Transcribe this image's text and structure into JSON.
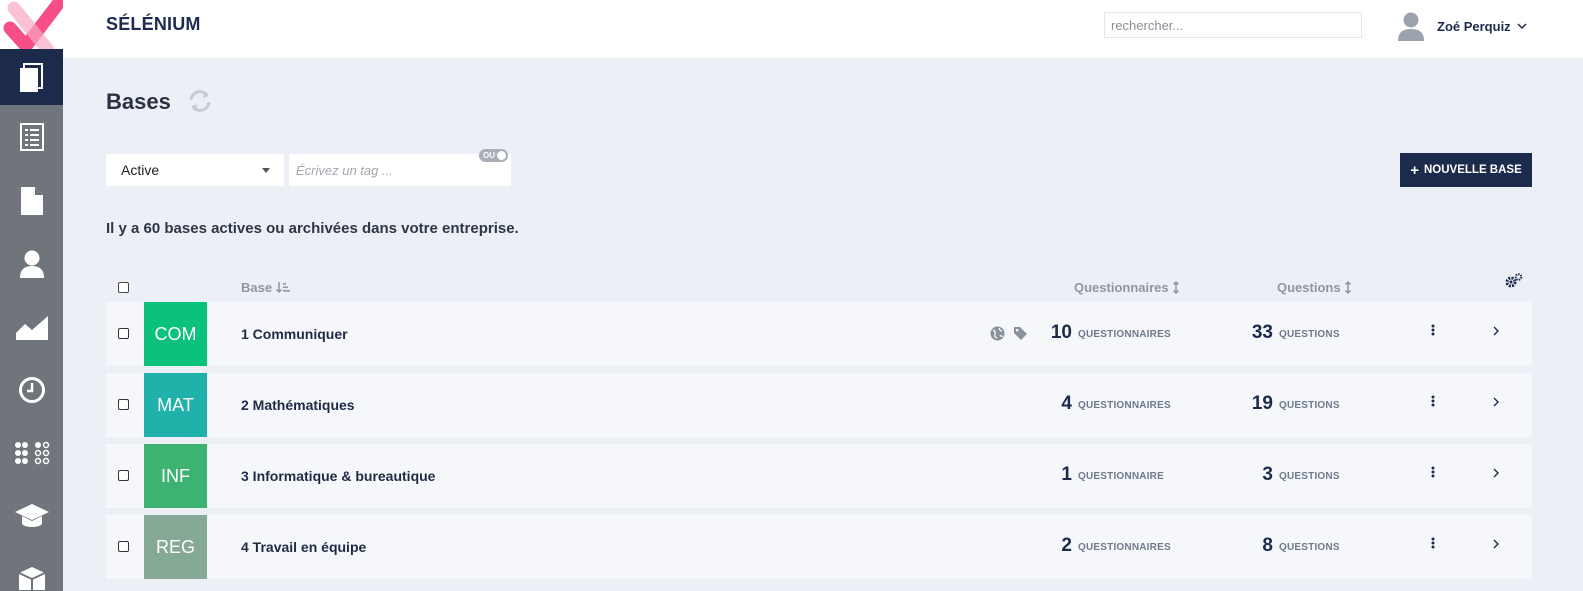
{
  "app": {
    "title": "SÉLÉNIUM"
  },
  "search": {
    "placeholder": "rechercher..."
  },
  "user": {
    "name": "Zoé Perquiz"
  },
  "sidebar": {
    "items": [
      {
        "icon": "documents-icon",
        "active": true
      },
      {
        "icon": "list-icon",
        "active": false
      },
      {
        "icon": "file-icon",
        "active": false
      },
      {
        "icon": "user-icon",
        "active": false
      },
      {
        "icon": "chart-icon",
        "active": false
      },
      {
        "icon": "clock-icon",
        "active": false
      },
      {
        "icon": "dots-grid-icon",
        "active": false
      },
      {
        "icon": "graduation-cap-icon",
        "active": false
      },
      {
        "icon": "box-icon",
        "active": false
      }
    ]
  },
  "page": {
    "title": "Bases"
  },
  "filters": {
    "status": "Active",
    "tag_placeholder": "Écrivez un tag ...",
    "ou_label": "OU"
  },
  "actions": {
    "new_base": "NOUVELLE BASE"
  },
  "summary": "Il y a 60 bases actives ou archivées dans votre entreprise.",
  "table": {
    "headers": {
      "base": "Base",
      "questionnaires": "Questionnaires",
      "questions": "Questions"
    },
    "rows": [
      {
        "code": "COM",
        "color": "#0cc17b",
        "name": "1 Communiquer",
        "has_icons": true,
        "questionnaires": "10",
        "questionnaires_label": "QUESTIONNAIRES",
        "questions": "33",
        "questions_label": "QUESTIONS"
      },
      {
        "code": "MAT",
        "color": "#20b2aa",
        "name": "2 Mathématiques",
        "has_icons": false,
        "questionnaires": "4",
        "questionnaires_label": "QUESTIONNAIRES",
        "questions": "19",
        "questions_label": "QUESTIONS"
      },
      {
        "code": "INF",
        "color": "#3cb371",
        "name": "3 Informatique & bureautique",
        "has_icons": false,
        "questionnaires": "1",
        "questionnaires_label": "QUESTIONNAIRE",
        "questions": "3",
        "questions_label": "QUESTIONS"
      },
      {
        "code": "REG",
        "color": "#86a995",
        "name": "4 Travail en équipe",
        "has_icons": false,
        "questionnaires": "2",
        "questionnaires_label": "QUESTIONNAIRES",
        "questions": "8",
        "questions_label": "QUESTIONS"
      }
    ]
  },
  "colors": {
    "primary": "#1c2b4c",
    "sidebar": "#6f757b",
    "background": "#ecf0f6",
    "logo_pink": "#f5457f"
  }
}
